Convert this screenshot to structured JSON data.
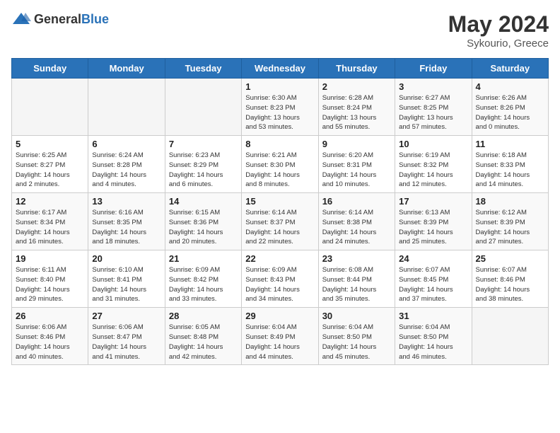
{
  "header": {
    "logo_general": "General",
    "logo_blue": "Blue",
    "month_year": "May 2024",
    "location": "Sykourio, Greece"
  },
  "days_of_week": [
    "Sunday",
    "Monday",
    "Tuesday",
    "Wednesday",
    "Thursday",
    "Friday",
    "Saturday"
  ],
  "weeks": [
    [
      {
        "day": "",
        "info": ""
      },
      {
        "day": "",
        "info": ""
      },
      {
        "day": "",
        "info": ""
      },
      {
        "day": "1",
        "info": "Sunrise: 6:30 AM\nSunset: 8:23 PM\nDaylight: 13 hours\nand 53 minutes."
      },
      {
        "day": "2",
        "info": "Sunrise: 6:28 AM\nSunset: 8:24 PM\nDaylight: 13 hours\nand 55 minutes."
      },
      {
        "day": "3",
        "info": "Sunrise: 6:27 AM\nSunset: 8:25 PM\nDaylight: 13 hours\nand 57 minutes."
      },
      {
        "day": "4",
        "info": "Sunrise: 6:26 AM\nSunset: 8:26 PM\nDaylight: 14 hours\nand 0 minutes."
      }
    ],
    [
      {
        "day": "5",
        "info": "Sunrise: 6:25 AM\nSunset: 8:27 PM\nDaylight: 14 hours\nand 2 minutes."
      },
      {
        "day": "6",
        "info": "Sunrise: 6:24 AM\nSunset: 8:28 PM\nDaylight: 14 hours\nand 4 minutes."
      },
      {
        "day": "7",
        "info": "Sunrise: 6:23 AM\nSunset: 8:29 PM\nDaylight: 14 hours\nand 6 minutes."
      },
      {
        "day": "8",
        "info": "Sunrise: 6:21 AM\nSunset: 8:30 PM\nDaylight: 14 hours\nand 8 minutes."
      },
      {
        "day": "9",
        "info": "Sunrise: 6:20 AM\nSunset: 8:31 PM\nDaylight: 14 hours\nand 10 minutes."
      },
      {
        "day": "10",
        "info": "Sunrise: 6:19 AM\nSunset: 8:32 PM\nDaylight: 14 hours\nand 12 minutes."
      },
      {
        "day": "11",
        "info": "Sunrise: 6:18 AM\nSunset: 8:33 PM\nDaylight: 14 hours\nand 14 minutes."
      }
    ],
    [
      {
        "day": "12",
        "info": "Sunrise: 6:17 AM\nSunset: 8:34 PM\nDaylight: 14 hours\nand 16 minutes."
      },
      {
        "day": "13",
        "info": "Sunrise: 6:16 AM\nSunset: 8:35 PM\nDaylight: 14 hours\nand 18 minutes."
      },
      {
        "day": "14",
        "info": "Sunrise: 6:15 AM\nSunset: 8:36 PM\nDaylight: 14 hours\nand 20 minutes."
      },
      {
        "day": "15",
        "info": "Sunrise: 6:14 AM\nSunset: 8:37 PM\nDaylight: 14 hours\nand 22 minutes."
      },
      {
        "day": "16",
        "info": "Sunrise: 6:14 AM\nSunset: 8:38 PM\nDaylight: 14 hours\nand 24 minutes."
      },
      {
        "day": "17",
        "info": "Sunrise: 6:13 AM\nSunset: 8:39 PM\nDaylight: 14 hours\nand 25 minutes."
      },
      {
        "day": "18",
        "info": "Sunrise: 6:12 AM\nSunset: 8:39 PM\nDaylight: 14 hours\nand 27 minutes."
      }
    ],
    [
      {
        "day": "19",
        "info": "Sunrise: 6:11 AM\nSunset: 8:40 PM\nDaylight: 14 hours\nand 29 minutes."
      },
      {
        "day": "20",
        "info": "Sunrise: 6:10 AM\nSunset: 8:41 PM\nDaylight: 14 hours\nand 31 minutes."
      },
      {
        "day": "21",
        "info": "Sunrise: 6:09 AM\nSunset: 8:42 PM\nDaylight: 14 hours\nand 33 minutes."
      },
      {
        "day": "22",
        "info": "Sunrise: 6:09 AM\nSunset: 8:43 PM\nDaylight: 14 hours\nand 34 minutes."
      },
      {
        "day": "23",
        "info": "Sunrise: 6:08 AM\nSunset: 8:44 PM\nDaylight: 14 hours\nand 35 minutes."
      },
      {
        "day": "24",
        "info": "Sunrise: 6:07 AM\nSunset: 8:45 PM\nDaylight: 14 hours\nand 37 minutes."
      },
      {
        "day": "25",
        "info": "Sunrise: 6:07 AM\nSunset: 8:46 PM\nDaylight: 14 hours\nand 38 minutes."
      }
    ],
    [
      {
        "day": "26",
        "info": "Sunrise: 6:06 AM\nSunset: 8:46 PM\nDaylight: 14 hours\nand 40 minutes."
      },
      {
        "day": "27",
        "info": "Sunrise: 6:06 AM\nSunset: 8:47 PM\nDaylight: 14 hours\nand 41 minutes."
      },
      {
        "day": "28",
        "info": "Sunrise: 6:05 AM\nSunset: 8:48 PM\nDaylight: 14 hours\nand 42 minutes."
      },
      {
        "day": "29",
        "info": "Sunrise: 6:04 AM\nSunset: 8:49 PM\nDaylight: 14 hours\nand 44 minutes."
      },
      {
        "day": "30",
        "info": "Sunrise: 6:04 AM\nSunset: 8:50 PM\nDaylight: 14 hours\nand 45 minutes."
      },
      {
        "day": "31",
        "info": "Sunrise: 6:04 AM\nSunset: 8:50 PM\nDaylight: 14 hours\nand 46 minutes."
      },
      {
        "day": "",
        "info": ""
      }
    ]
  ]
}
